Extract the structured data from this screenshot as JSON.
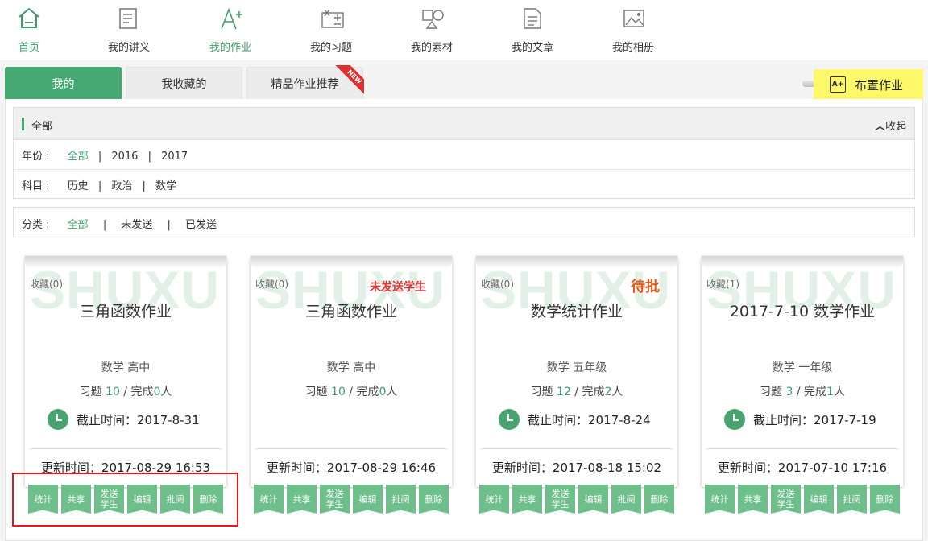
{
  "nav": {
    "items": [
      {
        "label": "首页",
        "icon": "home-icon"
      },
      {
        "label": "我的讲义",
        "icon": "lecture-icon"
      },
      {
        "label": "我的作业",
        "icon": "homework-icon"
      },
      {
        "label": "我的习题",
        "icon": "exercise-icon"
      },
      {
        "label": "我的素材",
        "icon": "material-icon"
      },
      {
        "label": "我的文章",
        "icon": "article-icon"
      },
      {
        "label": "我的相册",
        "icon": "album-icon"
      }
    ],
    "active_color": "#3e9e6c"
  },
  "tabs": [
    {
      "label": "我的"
    },
    {
      "label": "我收藏的"
    },
    {
      "label": "精品作业推荐"
    }
  ],
  "new_badge": "NEW",
  "assign_button": {
    "label": "布置作业",
    "icon_text": "A+"
  },
  "filter": {
    "header": "全部",
    "collapse": "收起",
    "year_label": "年份 :",
    "years": [
      "全部",
      "2016",
      "2017"
    ],
    "subject_label": "科目 :",
    "subjects": [
      "历史",
      "政治",
      "数学"
    ],
    "class_label": "分类 :",
    "classes": [
      "全部",
      "未发送",
      "已发送"
    ],
    "sep": "|"
  },
  "cards": [
    {
      "watermark": "SHUXUE",
      "fav": "收藏(0)",
      "stamp": "",
      "title": "三角函数作业",
      "subject": "数学  高中",
      "stats_a": "习题 ",
      "count": "10",
      "stats_b": " / 完成",
      "done": "0",
      "stats_c": "人",
      "deadline": "截止时间：2017-8-31",
      "updated": "更新时间：2017-08-29 16:53"
    },
    {
      "watermark": "SHUXUE",
      "fav": "收藏(0)",
      "stamp": "未发送学生",
      "title": "三角函数作业",
      "subject": "数学  高中",
      "stats_a": "习题 ",
      "count": "10",
      "stats_b": " / 完成",
      "done": "0",
      "stats_c": "人",
      "deadline": "",
      "updated": "更新时间：2017-08-29 16:46"
    },
    {
      "watermark": "SHUXUE",
      "fav": "收藏(0)",
      "stamp": "待批",
      "title": "数学统计作业",
      "subject": "数学  五年级",
      "stats_a": "习题 ",
      "count": "12",
      "stats_b": " / 完成",
      "done": "2",
      "stats_c": "人",
      "deadline": "截止时间：2017-8-24",
      "updated": "更新时间：2017-08-18 15:02"
    },
    {
      "watermark": "SHUXUE",
      "fav": "收藏(1)",
      "stamp": "",
      "title": "2017-7-10 数学作业",
      "subject": "数学  一年级",
      "stats_a": "习题 ",
      "count": "3",
      "stats_b": " / 完成",
      "done": "1",
      "stats_c": "人",
      "deadline": "截止时间：2017-7-19",
      "updated": "更新时间：2017-07-10 17:16"
    }
  ],
  "actions": [
    "统计",
    "共享",
    "发送学生",
    "编辑",
    "批阅",
    "删除"
  ],
  "colors": {
    "accent": "#46a873",
    "action_btn": "#6ebf8b",
    "highlight": "#fff86b",
    "stamp_red": "#e0312f"
  }
}
